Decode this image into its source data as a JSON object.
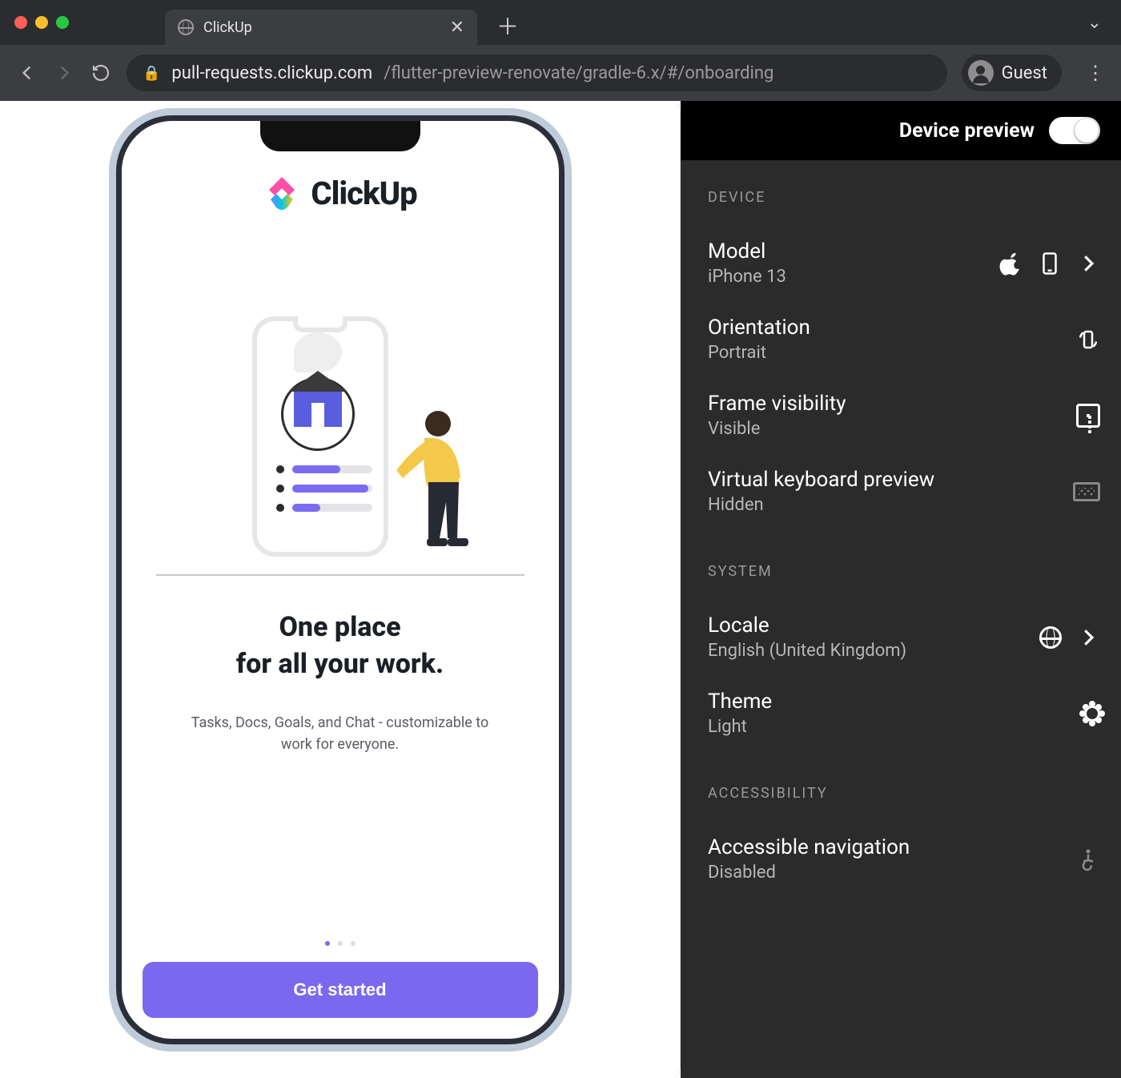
{
  "browser": {
    "tab_title": "ClickUp",
    "url_host": "pull-requests.clickup.com",
    "url_path": "/flutter-preview-renovate/gradle-6.x/#/onboarding",
    "profile_label": "Guest"
  },
  "phone": {
    "brand": "ClickUp",
    "headline_line1": "One place",
    "headline_line2": "for all your work.",
    "subtext": "Tasks, Docs, Goals, and Chat - customizable to work for everyone.",
    "cta": "Get started",
    "pager": {
      "count": 3,
      "active": 0
    }
  },
  "panel": {
    "title": "Device preview",
    "toggle_on": true,
    "sections": {
      "device": {
        "label": "DEVICE",
        "rows": {
          "model": {
            "title": "Model",
            "value": "iPhone 13"
          },
          "orientation": {
            "title": "Orientation",
            "value": "Portrait"
          },
          "frame": {
            "title": "Frame visibility",
            "value": "Visible"
          },
          "keyboard": {
            "title": "Virtual keyboard preview",
            "value": "Hidden"
          }
        }
      },
      "system": {
        "label": "SYSTEM",
        "rows": {
          "locale": {
            "title": "Locale",
            "value": "English (United Kingdom)"
          },
          "theme": {
            "title": "Theme",
            "value": "Light"
          }
        }
      },
      "accessibility": {
        "label": "ACCESSIBILITY",
        "rows": {
          "nav": {
            "title": "Accessible navigation",
            "value": "Disabled"
          }
        }
      }
    }
  }
}
